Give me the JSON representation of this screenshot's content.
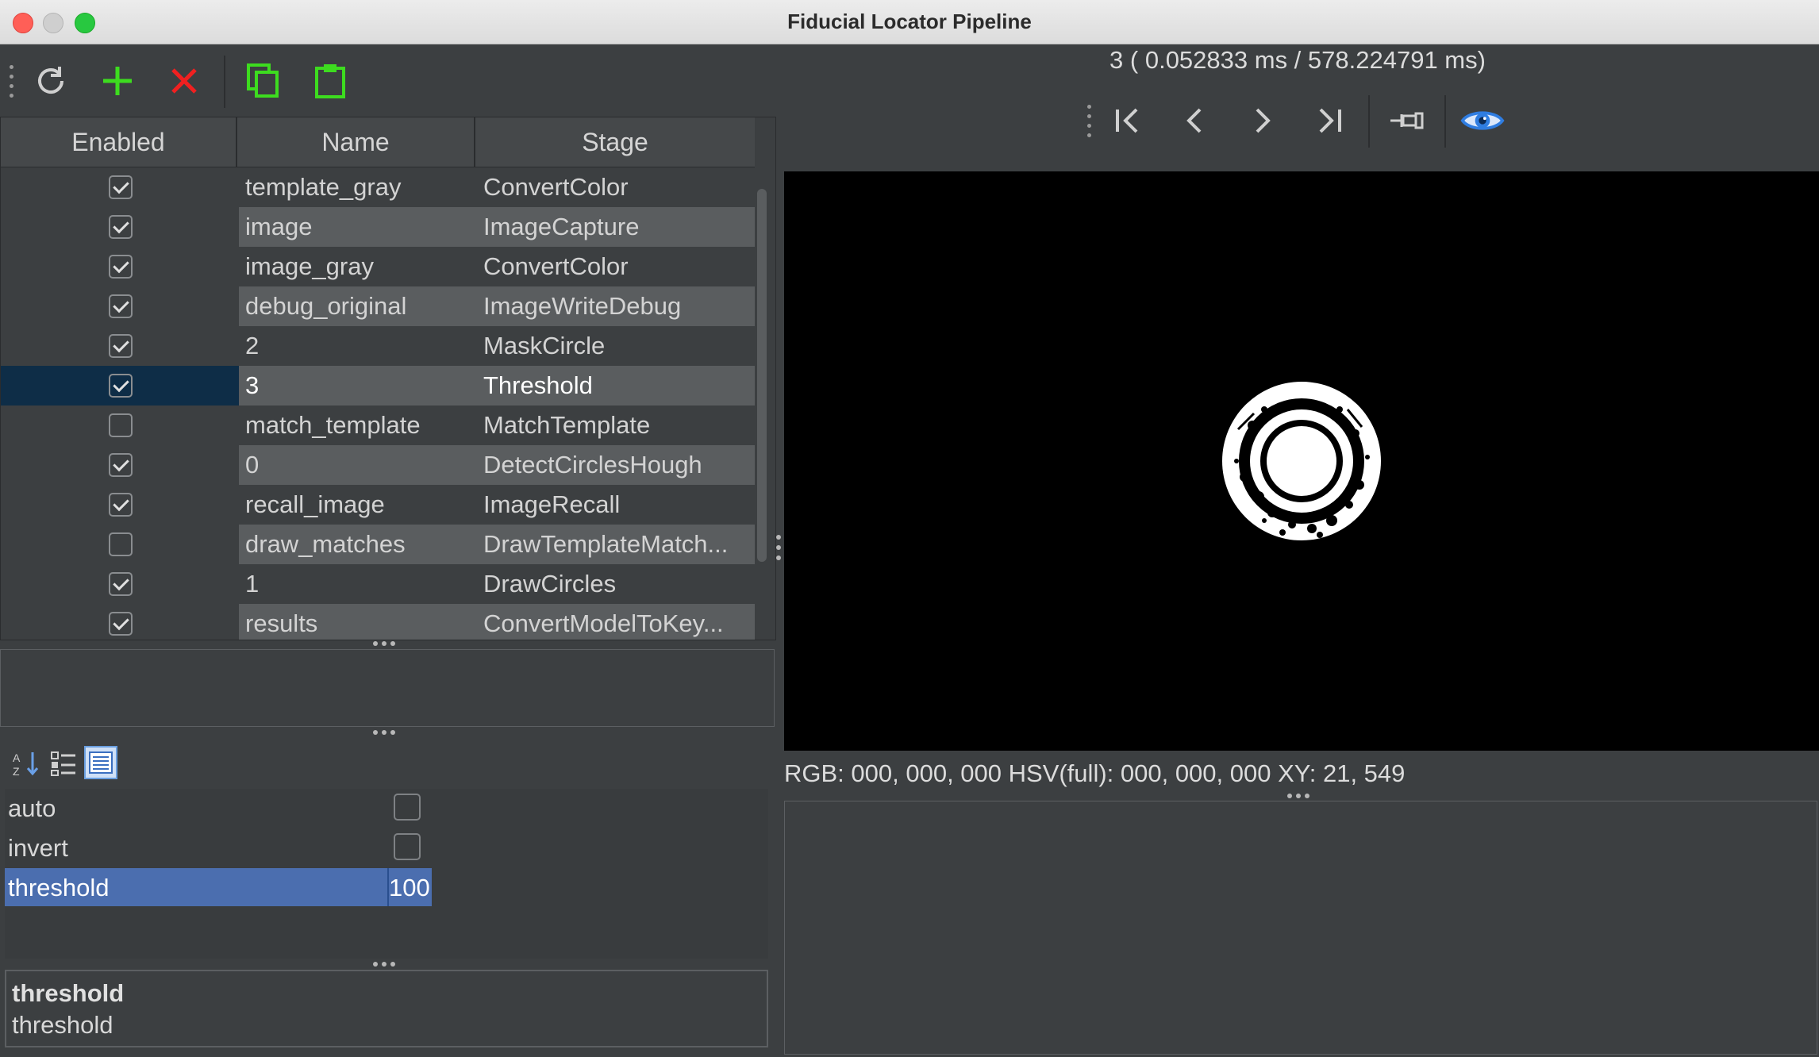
{
  "window": {
    "title": "Fiducial Locator Pipeline"
  },
  "toolbar": {
    "buttons": [
      {
        "name": "refresh",
        "icon": "refresh-icon"
      },
      {
        "name": "add",
        "icon": "plus-icon"
      },
      {
        "name": "remove",
        "icon": "close-icon"
      },
      {
        "name": "copy",
        "icon": "copy-icon"
      },
      {
        "name": "paste",
        "icon": "clipboard-icon"
      }
    ]
  },
  "pipeline_table": {
    "headers": {
      "enabled": "Enabled",
      "name": "Name",
      "stage": "Stage"
    },
    "rows": [
      {
        "enabled": true,
        "name": "template_gray",
        "stage": "ConvertColor"
      },
      {
        "enabled": true,
        "name": "image",
        "stage": "ImageCapture"
      },
      {
        "enabled": true,
        "name": "image_gray",
        "stage": "ConvertColor"
      },
      {
        "enabled": true,
        "name": "debug_original",
        "stage": "ImageWriteDebug"
      },
      {
        "enabled": true,
        "name": "2",
        "stage": "MaskCircle"
      },
      {
        "enabled": true,
        "name": "3",
        "stage": "Threshold",
        "selected": true
      },
      {
        "enabled": false,
        "name": "match_template",
        "stage": "MatchTemplate"
      },
      {
        "enabled": true,
        "name": "0",
        "stage": "DetectCirclesHough"
      },
      {
        "enabled": true,
        "name": "recall_image",
        "stage": "ImageRecall"
      },
      {
        "enabled": false,
        "name": "draw_matches",
        "stage": "DrawTemplateMatch..."
      },
      {
        "enabled": true,
        "name": "1",
        "stage": "DrawCircles"
      },
      {
        "enabled": true,
        "name": "results",
        "stage": "ConvertModelToKey..."
      }
    ]
  },
  "properties": {
    "view_buttons": [
      {
        "name": "sort-alpha",
        "icon": "sort-alpha-icon"
      },
      {
        "name": "categorized",
        "icon": "categorized-icon"
      },
      {
        "name": "list-view",
        "icon": "list-view-icon",
        "active": true
      }
    ],
    "items": {
      "auto": {
        "label": "auto",
        "checked": false
      },
      "invert": {
        "label": "invert",
        "checked": false
      },
      "threshold": {
        "label": "threshold",
        "value": "100"
      }
    },
    "description": {
      "title": "threshold",
      "text": "threshold"
    }
  },
  "viewer": {
    "timing": "3 ( 0.052833 ms / 578.224791 ms)",
    "nav_buttons": [
      {
        "name": "first",
        "icon": "first-icon"
      },
      {
        "name": "previous",
        "icon": "chevron-left-icon"
      },
      {
        "name": "next",
        "icon": "chevron-right-icon"
      },
      {
        "name": "last",
        "icon": "last-icon"
      },
      {
        "name": "pin",
        "icon": "pin-icon"
      },
      {
        "name": "view",
        "icon": "eye-icon"
      }
    ],
    "pixel_info": "RGB: 000, 000, 000 HSV(full): 000, 000, 000 XY: 21, 549"
  },
  "colors": {
    "background": "#3c3f41",
    "selection": "#0e2d47",
    "property_selection": "#4b6eaf",
    "add_green": "#3ddc1f",
    "remove_red": "#f02020",
    "eye_blue": "#2f7de1"
  }
}
